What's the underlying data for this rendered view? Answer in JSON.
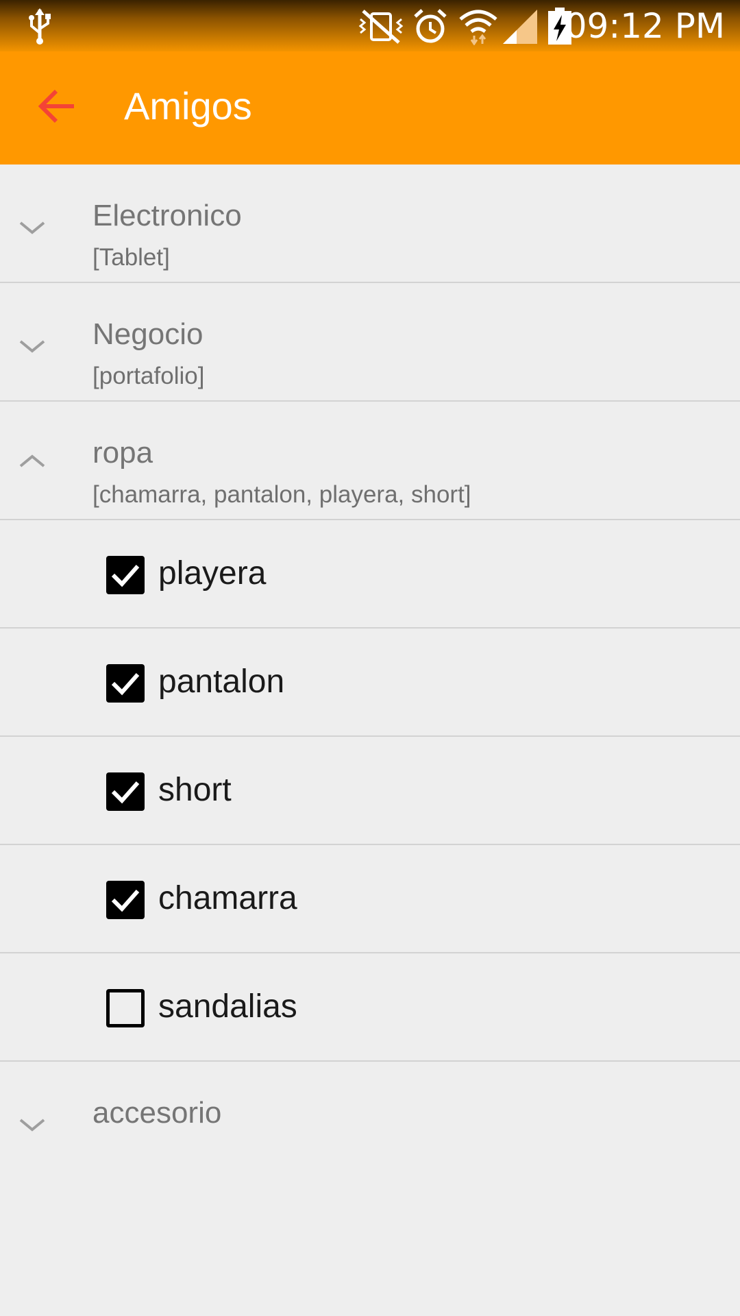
{
  "status_bar": {
    "time": "09:12 PM",
    "icons": [
      "usb-icon",
      "vibrate-off-icon",
      "alarm-icon",
      "wifi-icon",
      "signal-icon",
      "battery-charging-icon"
    ]
  },
  "app_bar": {
    "title": "Amigos",
    "back_icon": "arrow-back-icon",
    "accent_color": "#ff9800",
    "back_icon_color": "#f44336"
  },
  "groups": [
    {
      "title": "Electronico",
      "subtitle": "[Tablet]",
      "expanded": false
    },
    {
      "title": "Negocio",
      "subtitle": "[portafolio]",
      "expanded": false
    },
    {
      "title": "ropa",
      "subtitle": "[chamarra, pantalon, playera, short]",
      "expanded": true,
      "children": [
        {
          "label": "playera",
          "checked": true
        },
        {
          "label": "pantalon",
          "checked": true
        },
        {
          "label": "short",
          "checked": true
        },
        {
          "label": "chamarra",
          "checked": true
        },
        {
          "label": "sandalias",
          "checked": false
        }
      ]
    },
    {
      "title": "accesorio",
      "subtitle": "",
      "expanded": false
    }
  ]
}
